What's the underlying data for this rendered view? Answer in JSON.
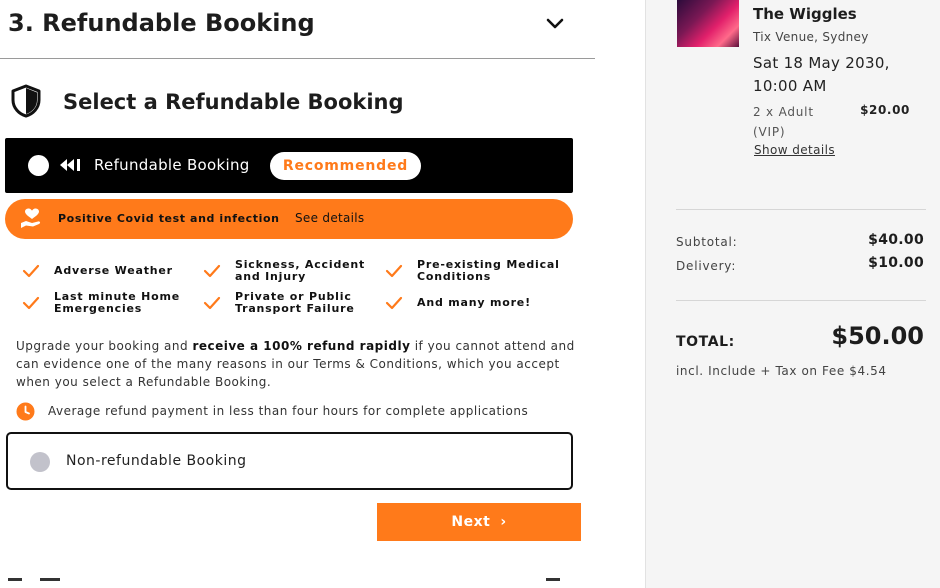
{
  "step": {
    "title": "3. Refundable Booking"
  },
  "section": {
    "title": "Select a Refundable Booking"
  },
  "refundable_option": {
    "label": "Refundable Booking",
    "badge": "Recommended"
  },
  "covid": {
    "text": "Positive Covid test and infection",
    "link": "See details"
  },
  "benefits": [
    "Adverse Weather",
    "Sickness, Accident\nand Injury",
    "Pre-existing Medical\nConditions",
    "Last minute Home\nEmergencies",
    "Private or Public\nTransport Failure",
    "And many more!"
  ],
  "description": {
    "part1": "Upgrade your booking and ",
    "bold": "receive a 100% refund rapidly",
    "part2": " if you cannot attend and can evidence one of the many reasons in our Terms & Conditions, which you accept when you select a Refundable Booking."
  },
  "average_refund": "Average refund payment in less than four hours for complete applications",
  "non_refundable_option": {
    "label": "Non-refundable Booking"
  },
  "next_button": {
    "label": "Next"
  },
  "sidebar": {
    "event_title": "The Wiggles",
    "venue": "Tix Venue, Sydney",
    "date": "Sat 18 May 2030, 10:00 AM",
    "ticket_desc": "2 x Adult (VIP)",
    "ticket_price": "$20.00",
    "show_details": "Show details",
    "subtotal_label": "Subtotal:",
    "subtotal_value": "$40.00",
    "delivery_label": "Delivery:",
    "delivery_value": "$10.00",
    "total_label": "TOTAL:",
    "total_value": "$50.00",
    "tax_note": "incl. Include + Tax on Fee $4.54"
  },
  "colors": {
    "accent": "#ff7a1a",
    "dark": "#000000",
    "sidebar_bg": "#f5f5f5"
  }
}
